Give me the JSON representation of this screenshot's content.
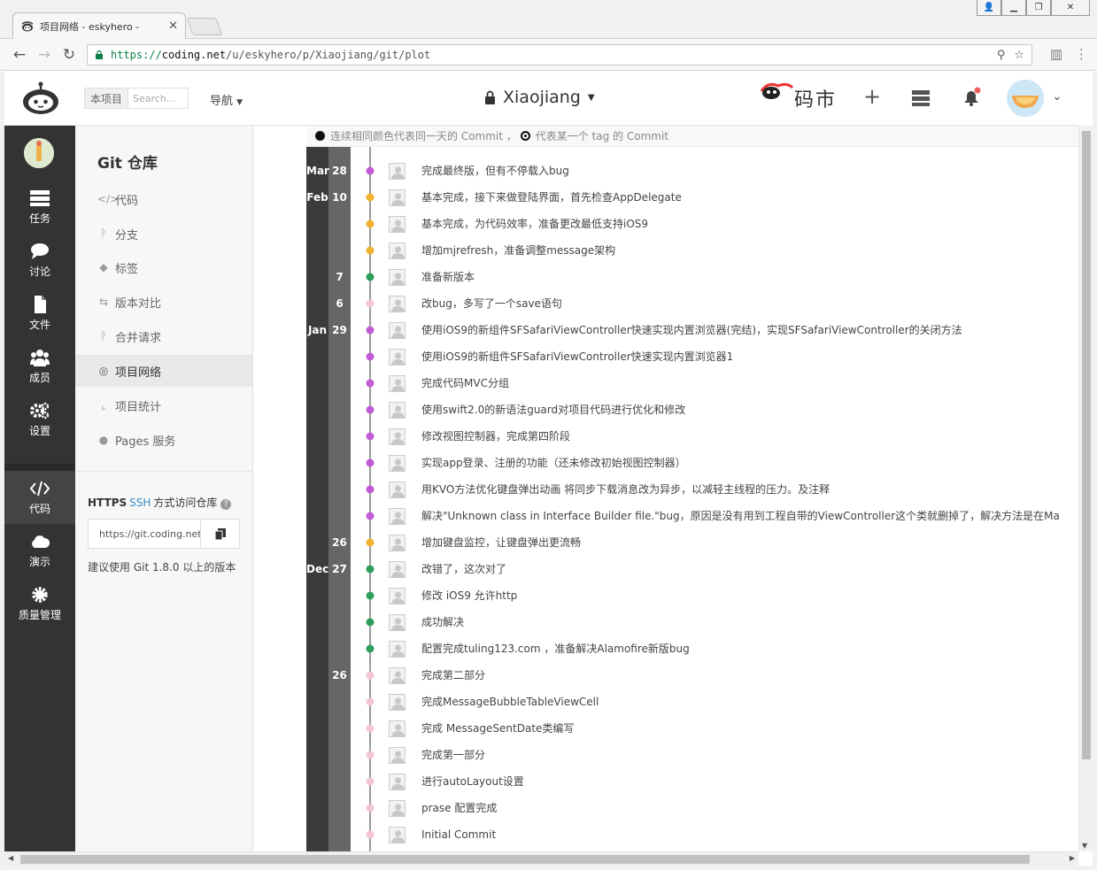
{
  "browser": {
    "tab_title": "项目网络 - eskyhero -",
    "url_scheme": "https://",
    "url_host": "coding.net",
    "url_path": "/u/eskyhero/p/Xiaojiang/git/plot"
  },
  "header": {
    "search_scope": "本项目",
    "search_placeholder": "Search...",
    "nav_label": "导航",
    "project_name": "Xiaojiang",
    "brand_text": "码市"
  },
  "sidebar": {
    "items": [
      {
        "label": "任务",
        "icon": "tasks-icon"
      },
      {
        "label": "讨论",
        "icon": "chat-icon"
      },
      {
        "label": "文件",
        "icon": "file-icon"
      },
      {
        "label": "成员",
        "icon": "members-icon"
      },
      {
        "label": "设置",
        "icon": "settings-icon"
      },
      {
        "label": "代码",
        "icon": "code-icon"
      },
      {
        "label": "演示",
        "icon": "cloud-icon"
      },
      {
        "label": "质量管理",
        "icon": "gear-icon"
      }
    ]
  },
  "subnav": {
    "title": "Git 仓库",
    "items": [
      {
        "label": "代码",
        "glyph": "</>"
      },
      {
        "label": "分支",
        "glyph": "ᚹ"
      },
      {
        "label": "标签",
        "glyph": "◆"
      },
      {
        "label": "版本对比",
        "glyph": "⇆"
      },
      {
        "label": "合并请求",
        "glyph": "ᚹ"
      },
      {
        "label": "项目网络",
        "glyph": "◎"
      },
      {
        "label": "项目统计",
        "glyph": "⌞"
      },
      {
        "label": "Pages 服务",
        "glyph": "●"
      }
    ],
    "access_https": "HTTPS",
    "access_ssh": "SSH",
    "access_text": "方式访问仓库",
    "clone_url": "https://git.coding.net/eskyhero/Xiaojiang.git",
    "hint": "建议使用 Git 1.8.0 以上的版本"
  },
  "legend": {
    "text1": "连续相同颜色代表同一天的 Commit ，",
    "text2": "代表某一个 tag 的 Commit"
  },
  "colors": {
    "purple": "#c15bd6",
    "orange": "#efb22f",
    "green": "#2f9e5c",
    "pink": "#f4c6d2",
    "line": "#9a9a9a"
  },
  "commits": [
    {
      "month": "Mar",
      "day": "28",
      "color": "purple",
      "message": "完成最终版，但有不停载入bug"
    },
    {
      "month": "Feb",
      "day": "10",
      "color": "orange",
      "message": "基本完成，接下来做登陆界面，首先检查AppDelegate"
    },
    {
      "month": "",
      "day": "",
      "color": "orange",
      "message": "基本完成，为代码效率，准备更改最低支持iOS9"
    },
    {
      "month": "",
      "day": "",
      "color": "orange",
      "message": "增加mjrefresh，准备调整message架构"
    },
    {
      "month": "",
      "day": "7",
      "color": "green",
      "message": "准备新版本"
    },
    {
      "month": "",
      "day": "6",
      "color": "pink",
      "message": "改bug，多写了一个save语句"
    },
    {
      "month": "Jan",
      "day": "29",
      "color": "purple",
      "message": "使用iOS9的新组件SFSafariViewController快速实现内置浏览器(完结)，实现SFSafariViewController的关闭方法"
    },
    {
      "month": "",
      "day": "",
      "color": "purple",
      "message": "使用iOS9的新组件SFSafariViewController快速实现内置浏览器1"
    },
    {
      "month": "",
      "day": "",
      "color": "purple",
      "message": "完成代码MVC分组"
    },
    {
      "month": "",
      "day": "",
      "color": "purple",
      "message": "使用swift2.0的新语法guard对项目代码进行优化和修改"
    },
    {
      "month": "",
      "day": "",
      "color": "purple",
      "message": "修改视图控制器，完成第四阶段"
    },
    {
      "month": "",
      "day": "",
      "color": "purple",
      "message": "实现app登录、注册的功能（还未修改初始视图控制器）"
    },
    {
      "month": "",
      "day": "",
      "color": "purple",
      "message": "用KVO方法优化键盘弹出动画 将同步下载消息改为异步，以减轻主线程的压力。及注释"
    },
    {
      "month": "",
      "day": "",
      "color": "purple",
      "message": "解决\"Unknown class in Interface Builder file.\"bug，原因是没有用到工程自带的ViewController这个类就删掉了，解决方法是在Main.storyboard中"
    },
    {
      "month": "",
      "day": "26",
      "color": "orange",
      "message": "增加键盘监控，让键盘弹出更流畅"
    },
    {
      "month": "Dec",
      "day": "27",
      "color": "green",
      "message": "改错了，这次对了"
    },
    {
      "month": "",
      "day": "",
      "color": "green",
      "message": "修改 iOS9 允许http"
    },
    {
      "month": "",
      "day": "",
      "color": "green",
      "message": "成功解决"
    },
    {
      "month": "",
      "day": "",
      "color": "green",
      "message": "配置完成tuling123.com ，准备解决Alamofire新版bug"
    },
    {
      "month": "",
      "day": "26",
      "color": "pink",
      "message": "完成第二部分"
    },
    {
      "month": "",
      "day": "",
      "color": "pink",
      "message": "完成MessageBubbleTableViewCell"
    },
    {
      "month": "",
      "day": "",
      "color": "pink",
      "message": "完成 MessageSentDate类编写"
    },
    {
      "month": "",
      "day": "",
      "color": "pink",
      "message": "完成第一部分"
    },
    {
      "month": "",
      "day": "",
      "color": "pink",
      "message": "进行autoLayout设置"
    },
    {
      "month": "",
      "day": "",
      "color": "pink",
      "message": "prase 配置完成"
    },
    {
      "month": "",
      "day": "",
      "color": "pink",
      "message": "Initial Commit"
    }
  ]
}
